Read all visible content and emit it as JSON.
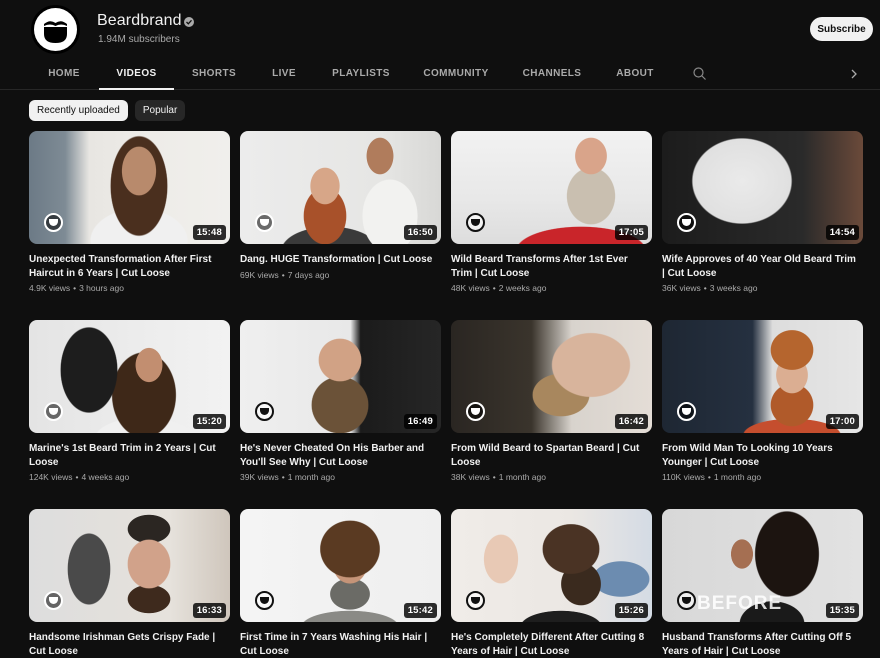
{
  "channel": {
    "name": "Beardbrand",
    "verified": true,
    "subscribers": "1.94M subscribers",
    "avatar_icon": "beard-logo-icon",
    "subscribe_label": "Subscribe"
  },
  "tabs": [
    {
      "label": "HOME",
      "active": false
    },
    {
      "label": "VIDEOS",
      "active": true
    },
    {
      "label": "SHORTS",
      "active": false
    },
    {
      "label": "LIVE",
      "active": false
    },
    {
      "label": "PLAYLISTS",
      "active": false
    },
    {
      "label": "COMMUNITY",
      "active": false
    },
    {
      "label": "CHANNELS",
      "active": false
    },
    {
      "label": "ABOUT",
      "active": false
    }
  ],
  "tab_icons": {
    "search": "search-icon",
    "next": "chevron-right-icon"
  },
  "filters": [
    {
      "label": "Recently uploaded",
      "active": true
    },
    {
      "label": "Popular",
      "active": false
    }
  ],
  "videos": [
    {
      "title": "Unexpected Transformation After First Haircut in 6 Years | Cut Loose",
      "views": "4.9K views",
      "age": "3 hours ago",
      "duration": "15:48"
    },
    {
      "title": "Dang. HUGE Transformation | Cut Loose",
      "views": "69K views",
      "age": "7 days ago",
      "duration": "16:50"
    },
    {
      "title": "Wild Beard Transforms After 1st Ever Trim | Cut Loose",
      "views": "48K views",
      "age": "2 weeks ago",
      "duration": "17:05"
    },
    {
      "title": "Wife Approves of 40 Year Old Beard Trim | Cut Loose",
      "views": "36K views",
      "age": "3 weeks ago",
      "duration": "14:54"
    },
    {
      "title": "Marine's 1st Beard Trim in 2 Years | Cut Loose",
      "views": "124K views",
      "age": "4 weeks ago",
      "duration": "15:20"
    },
    {
      "title": "He's Never Cheated On His Barber and You'll See Why | Cut Loose",
      "views": "39K views",
      "age": "1 month ago",
      "duration": "16:49"
    },
    {
      "title": "From Wild Beard to Spartan Beard | Cut Loose",
      "views": "38K views",
      "age": "1 month ago",
      "duration": "16:42"
    },
    {
      "title": "From Wild Man To Looking 10 Years Younger | Cut Loose",
      "views": "110K views",
      "age": "1 month ago",
      "duration": "17:00"
    },
    {
      "title": "Handsome Irishman Gets Crispy Fade | Cut Loose",
      "views": "",
      "age": "",
      "duration": "16:33"
    },
    {
      "title": "First Time in 7 Years Washing His Hair | Cut Loose",
      "views": "",
      "age": "",
      "duration": "15:42"
    },
    {
      "title": "He's Completely Different After Cutting 8 Years of Hair | Cut Loose",
      "views": "",
      "age": "",
      "duration": "15:26"
    },
    {
      "title": "Husband Transforms After Cutting Off 5 Years of Hair | Cut Loose",
      "views": "",
      "age": "",
      "duration": "15:35",
      "thumb_overlay_text": "BEFORE"
    }
  ]
}
